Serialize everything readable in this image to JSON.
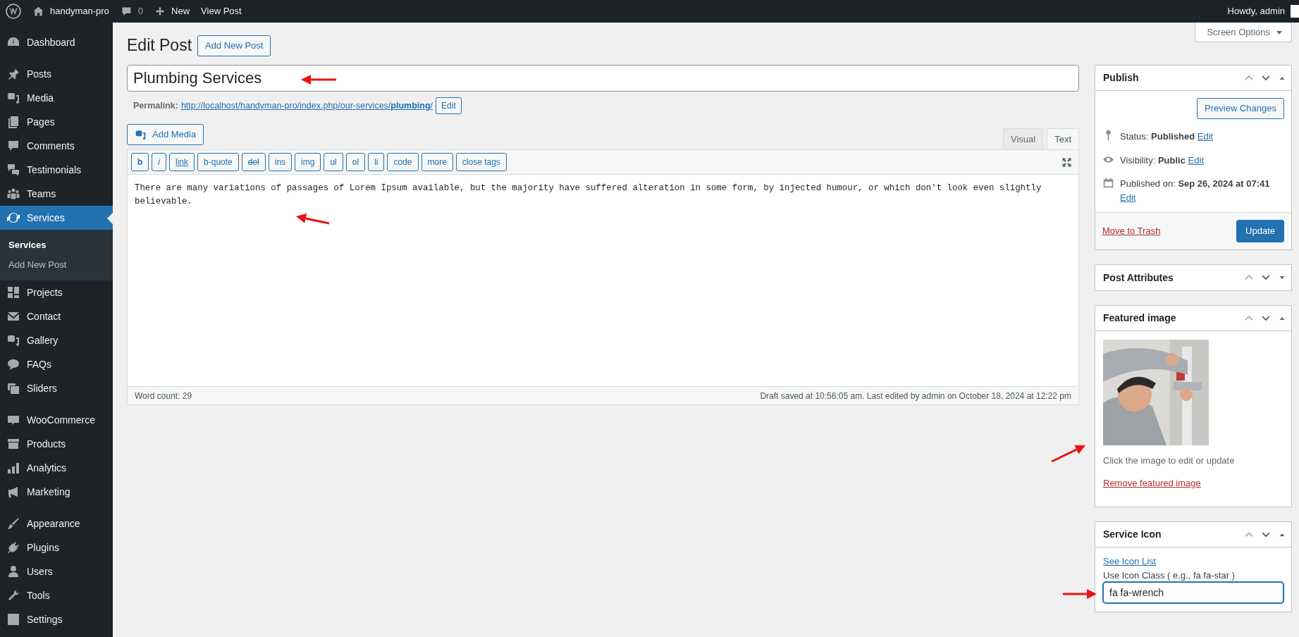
{
  "admin_bar": {
    "site": "handyman-pro",
    "comments": "0",
    "new": "New",
    "view": "View Post",
    "greeting": "Howdy, admin"
  },
  "sidebar": {
    "groups": [
      {
        "items": [
          {
            "label": "Dashboard",
            "selected": false
          }
        ]
      },
      {
        "items": [
          {
            "label": "Posts",
            "selected": false
          },
          {
            "label": "Media",
            "selected": false
          },
          {
            "label": "Pages",
            "selected": false
          },
          {
            "label": "Comments",
            "selected": false
          },
          {
            "label": "Testimonials",
            "selected": false
          },
          {
            "label": "Teams",
            "selected": false
          },
          {
            "label": "Services",
            "selected": true,
            "children": [
              {
                "label": "Services",
                "selected": true
              },
              {
                "label": "Add New Post",
                "selected": false
              }
            ]
          },
          {
            "label": "Projects",
            "selected": false
          },
          {
            "label": "Contact",
            "selected": false
          },
          {
            "label": "Gallery",
            "selected": false
          },
          {
            "label": "FAQs",
            "selected": false
          },
          {
            "label": "Sliders",
            "selected": false
          }
        ]
      },
      {
        "items": [
          {
            "label": "WooCommerce",
            "selected": false
          },
          {
            "label": "Products",
            "selected": false
          },
          {
            "label": "Analytics",
            "selected": false
          },
          {
            "label": "Marketing",
            "selected": false
          }
        ]
      },
      {
        "items": [
          {
            "label": "Appearance",
            "selected": false
          },
          {
            "label": "Plugins",
            "selected": false
          },
          {
            "label": "Users",
            "selected": false
          },
          {
            "label": "Tools",
            "selected": false
          },
          {
            "label": "Settings",
            "selected": false
          }
        ]
      }
    ]
  },
  "screen_options": "Screen Options",
  "heading": "Edit Post",
  "add_new": "Add New Post",
  "title_field": {
    "value": "Plumbing Services"
  },
  "permalink": {
    "label": "Permalink:",
    "url": "http://localhost/handyman-pro/index.php/our-services/**plumbing**/",
    "edit": "Edit"
  },
  "editor": {
    "add_media": "Add Media",
    "tabs": [
      {
        "label": "Visual",
        "selected": false
      },
      {
        "label": "Text",
        "selected": true
      }
    ],
    "quicktags": [
      {
        "label": "b",
        "kind": "bold"
      },
      {
        "label": "i",
        "kind": "italic"
      },
      {
        "label": "link",
        "kind": "link"
      },
      {
        "label": "b-quote",
        "kind": "plain"
      },
      {
        "label": "del",
        "kind": "strike"
      },
      {
        "label": "ins",
        "kind": "plain"
      },
      {
        "label": "img",
        "kind": "plain"
      },
      {
        "label": "ul",
        "kind": "plain"
      },
      {
        "label": "ol",
        "kind": "plain"
      },
      {
        "label": "li",
        "kind": "plain"
      },
      {
        "label": "code",
        "kind": "plain"
      },
      {
        "label": "more",
        "kind": "plain"
      },
      {
        "label": "close tags",
        "kind": "plain"
      }
    ],
    "content": "There are many variations of passages of Lorem Ipsum available, but the majority have suffered alteration in some form, by injected humour, or which don't look even slightly believable.",
    "word_count": "Word count: 29",
    "draft_status": "Draft saved at 10:56:05 am. Last edited by admin on October 18, 2024 at 12:22 pm"
  },
  "boxes": [
    {
      "kind": "publish",
      "title": "Publish",
      "expanded": true,
      "preview": "Preview Changes",
      "rows": [
        {
          "text": "Status: **Published**",
          "edit": "Edit"
        },
        {
          "text": "Visibility: **Public**",
          "edit": "Edit"
        },
        {
          "text": "Published on: **Sep 26, 2024 at 07:41**",
          "edit": "Edit"
        }
      ],
      "trash": "Move to Trash",
      "update": "Update"
    },
    {
      "title": "Post Attributes",
      "expanded": false
    },
    {
      "kind": "featured_image",
      "title": "Featured image",
      "expanded": true,
      "hint": "Click the image to edit or update",
      "remove": "Remove featured image"
    },
    {
      "kind": "service_icon",
      "title": "Service Icon",
      "expanded": true,
      "link": "See Icon List",
      "label": "Use Icon Class ( e.g., fa fa-star )",
      "value": "fa fa-wrench",
      "focused": true
    }
  ]
}
